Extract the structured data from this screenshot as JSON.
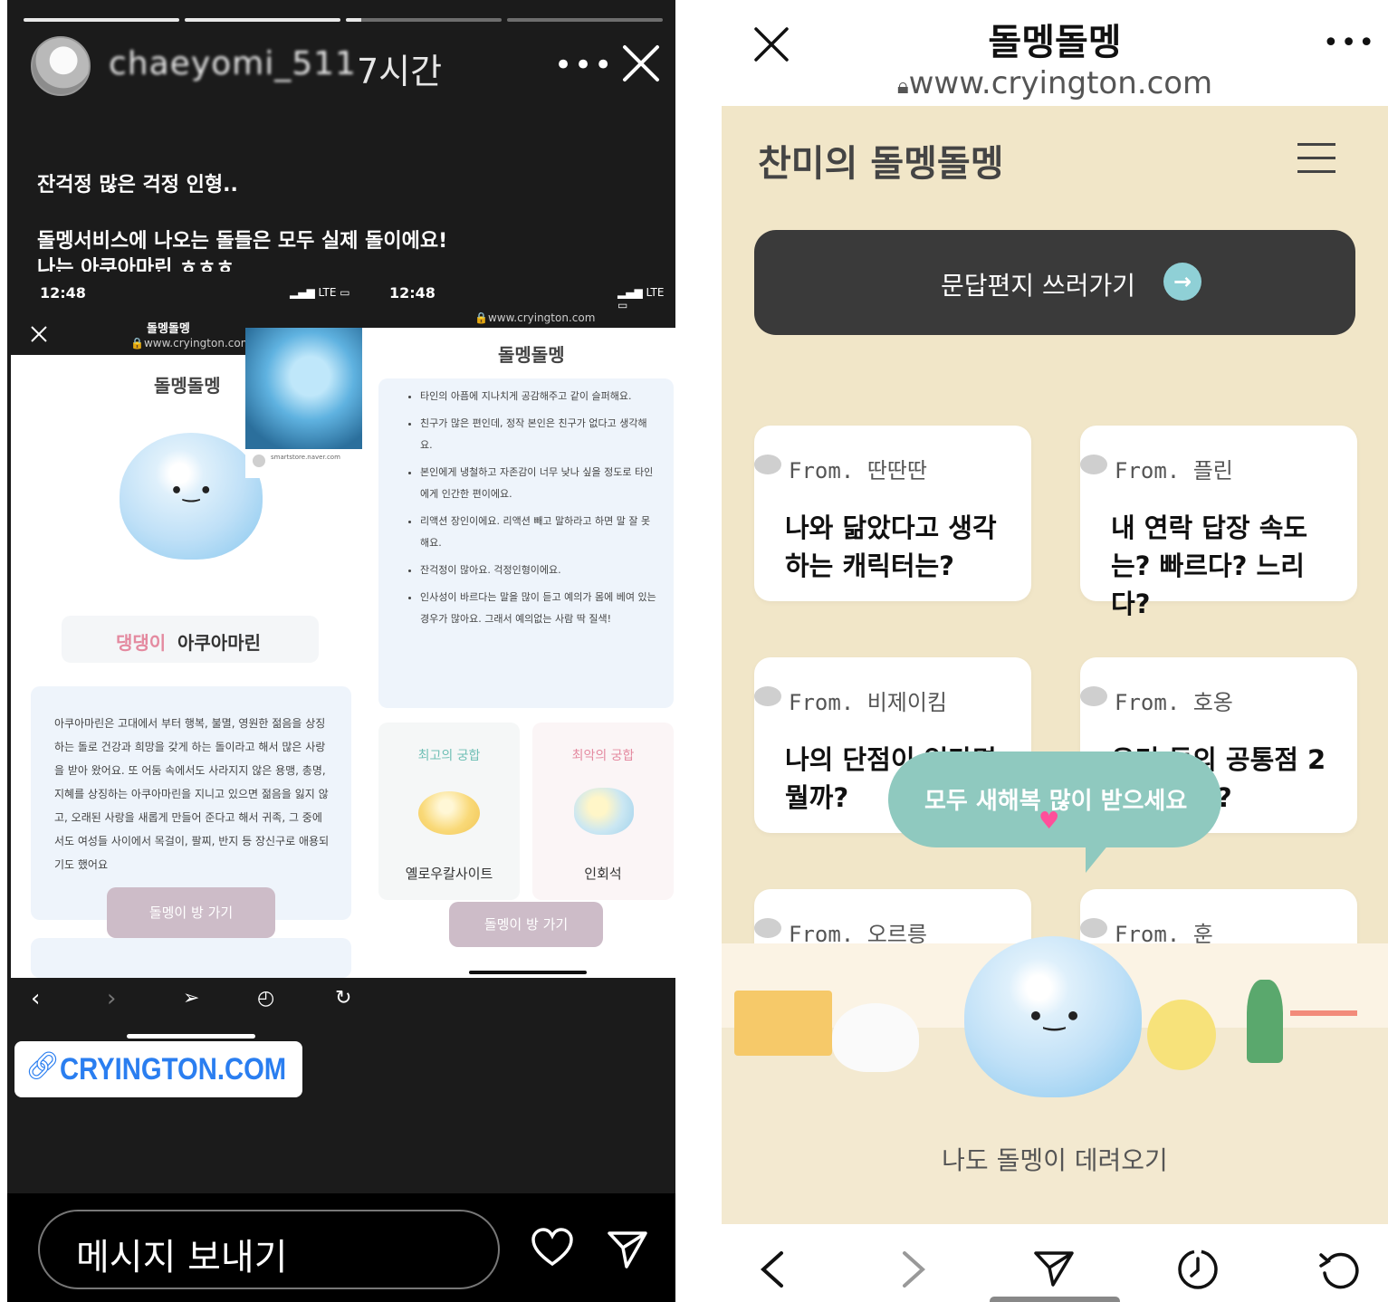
{
  "story": {
    "username": "chaeyomi_511",
    "time": "7시간",
    "more_icon": "more-horizontal-icon",
    "close_icon": "close-icon",
    "caption_line1": "잔걱정 많은 걱정 인형..",
    "caption_line2": "돌멩서비스에 나오는 돌들은 모두 실제 돌이에요!",
    "caption_line3": "나는 아쿠아마린 ㅎㅎㅎ",
    "link_sticker": "CRYINGTON.COM",
    "message_placeholder": "메시지 보내기",
    "heart_icon": "heart-icon",
    "send_icon": "send-icon",
    "embed": {
      "left": {
        "time": "12:48",
        "signal": "LTE",
        "title": "돌멩돌멩",
        "url": "www.cryington.com",
        "logo": "돌멩돌멩",
        "tag_prefix": "댕댕이",
        "tag_name": "아쿠아마린",
        "description": "아쿠아마린은 고대에서 부터 행복, 불멸, 영원한 젊음을 상징하는 돌로 건강과 희망을 갖게 하는 돌이라고 해서 많은 사랑을 받아 왔어요. 또 어둠 속에서도 사라지지 않은 용맹, 총명, 지혜를 상징하는 아쿠아마린을 지니고 있으면 젊음을 잃지 않고, 오래된 사랑을 새롭게 만들어 준다고 해서 귀족, 그 중에서도 여성들 사이에서 목걸이, 팔찌, 반지 등 장신구로 애용되기도 했어요",
        "button": "돌멩이 방 가기",
        "store_site": "smartstore.naver.com"
      },
      "right": {
        "time": "12:48",
        "signal": "LTE",
        "url": "www.cryington.com",
        "logo": "돌멩돌멩",
        "bullets": [
          "타인의 아픔에 지나치게 공감해주고 같이 슬퍼해요.",
          "친구가 많은 편인데, 정작 본인은 친구가 없다고 생각해요.",
          "본인에게 냉철하고 자존감이 너무 낮나 싶을 정도로 타인에게 인간한 편이에요.",
          "리액션 장인이에요. 리액션 빼고 말하라고 하면 말 잘 못해요.",
          "잔걱정이 많아요. 걱정인형이에요.",
          "인사성이 바르다는 말을 많이 듣고 예의가 몸에 베여 있는 경우가 많아요. 그래서 예의없는 사람 딱 질색!"
        ],
        "best_label": "최고의 궁합",
        "worst_label": "최악의 궁합",
        "best_name": "옐로우칼사이트",
        "worst_name": "인회석",
        "button": "돌멩이 방 가기"
      }
    }
  },
  "browser": {
    "title": "돌멩돌멩",
    "url": "www.cryington.com",
    "close_icon": "close-icon",
    "more_icon": "more-horizontal-icon",
    "site_logo": "찬미의 돌멩돌멩",
    "write_button": "문답편지 쓰러가기",
    "cards": [
      {
        "from": "From. 딴딴딴",
        "question": "나와 닮았다고 생각하는 캐릭터는?"
      },
      {
        "from": "From. 플린",
        "question": "내 연락 답장 속도는? 빠르다? 느리다?"
      },
      {
        "from": "From. 비제이킴",
        "question": "나의 단점이 있다면 뭘까?"
      },
      {
        "from": "From. 호옹",
        "question": "우리 둘의 공통점 2가 있을까?"
      },
      {
        "from": "From. 오르릉",
        "question": ""
      },
      {
        "from": "From. 훈",
        "question": ""
      }
    ],
    "speech_bubble": "모두 새해복 많이 받으세요",
    "adopt_text": "나도 돌멩이 데려오기"
  }
}
